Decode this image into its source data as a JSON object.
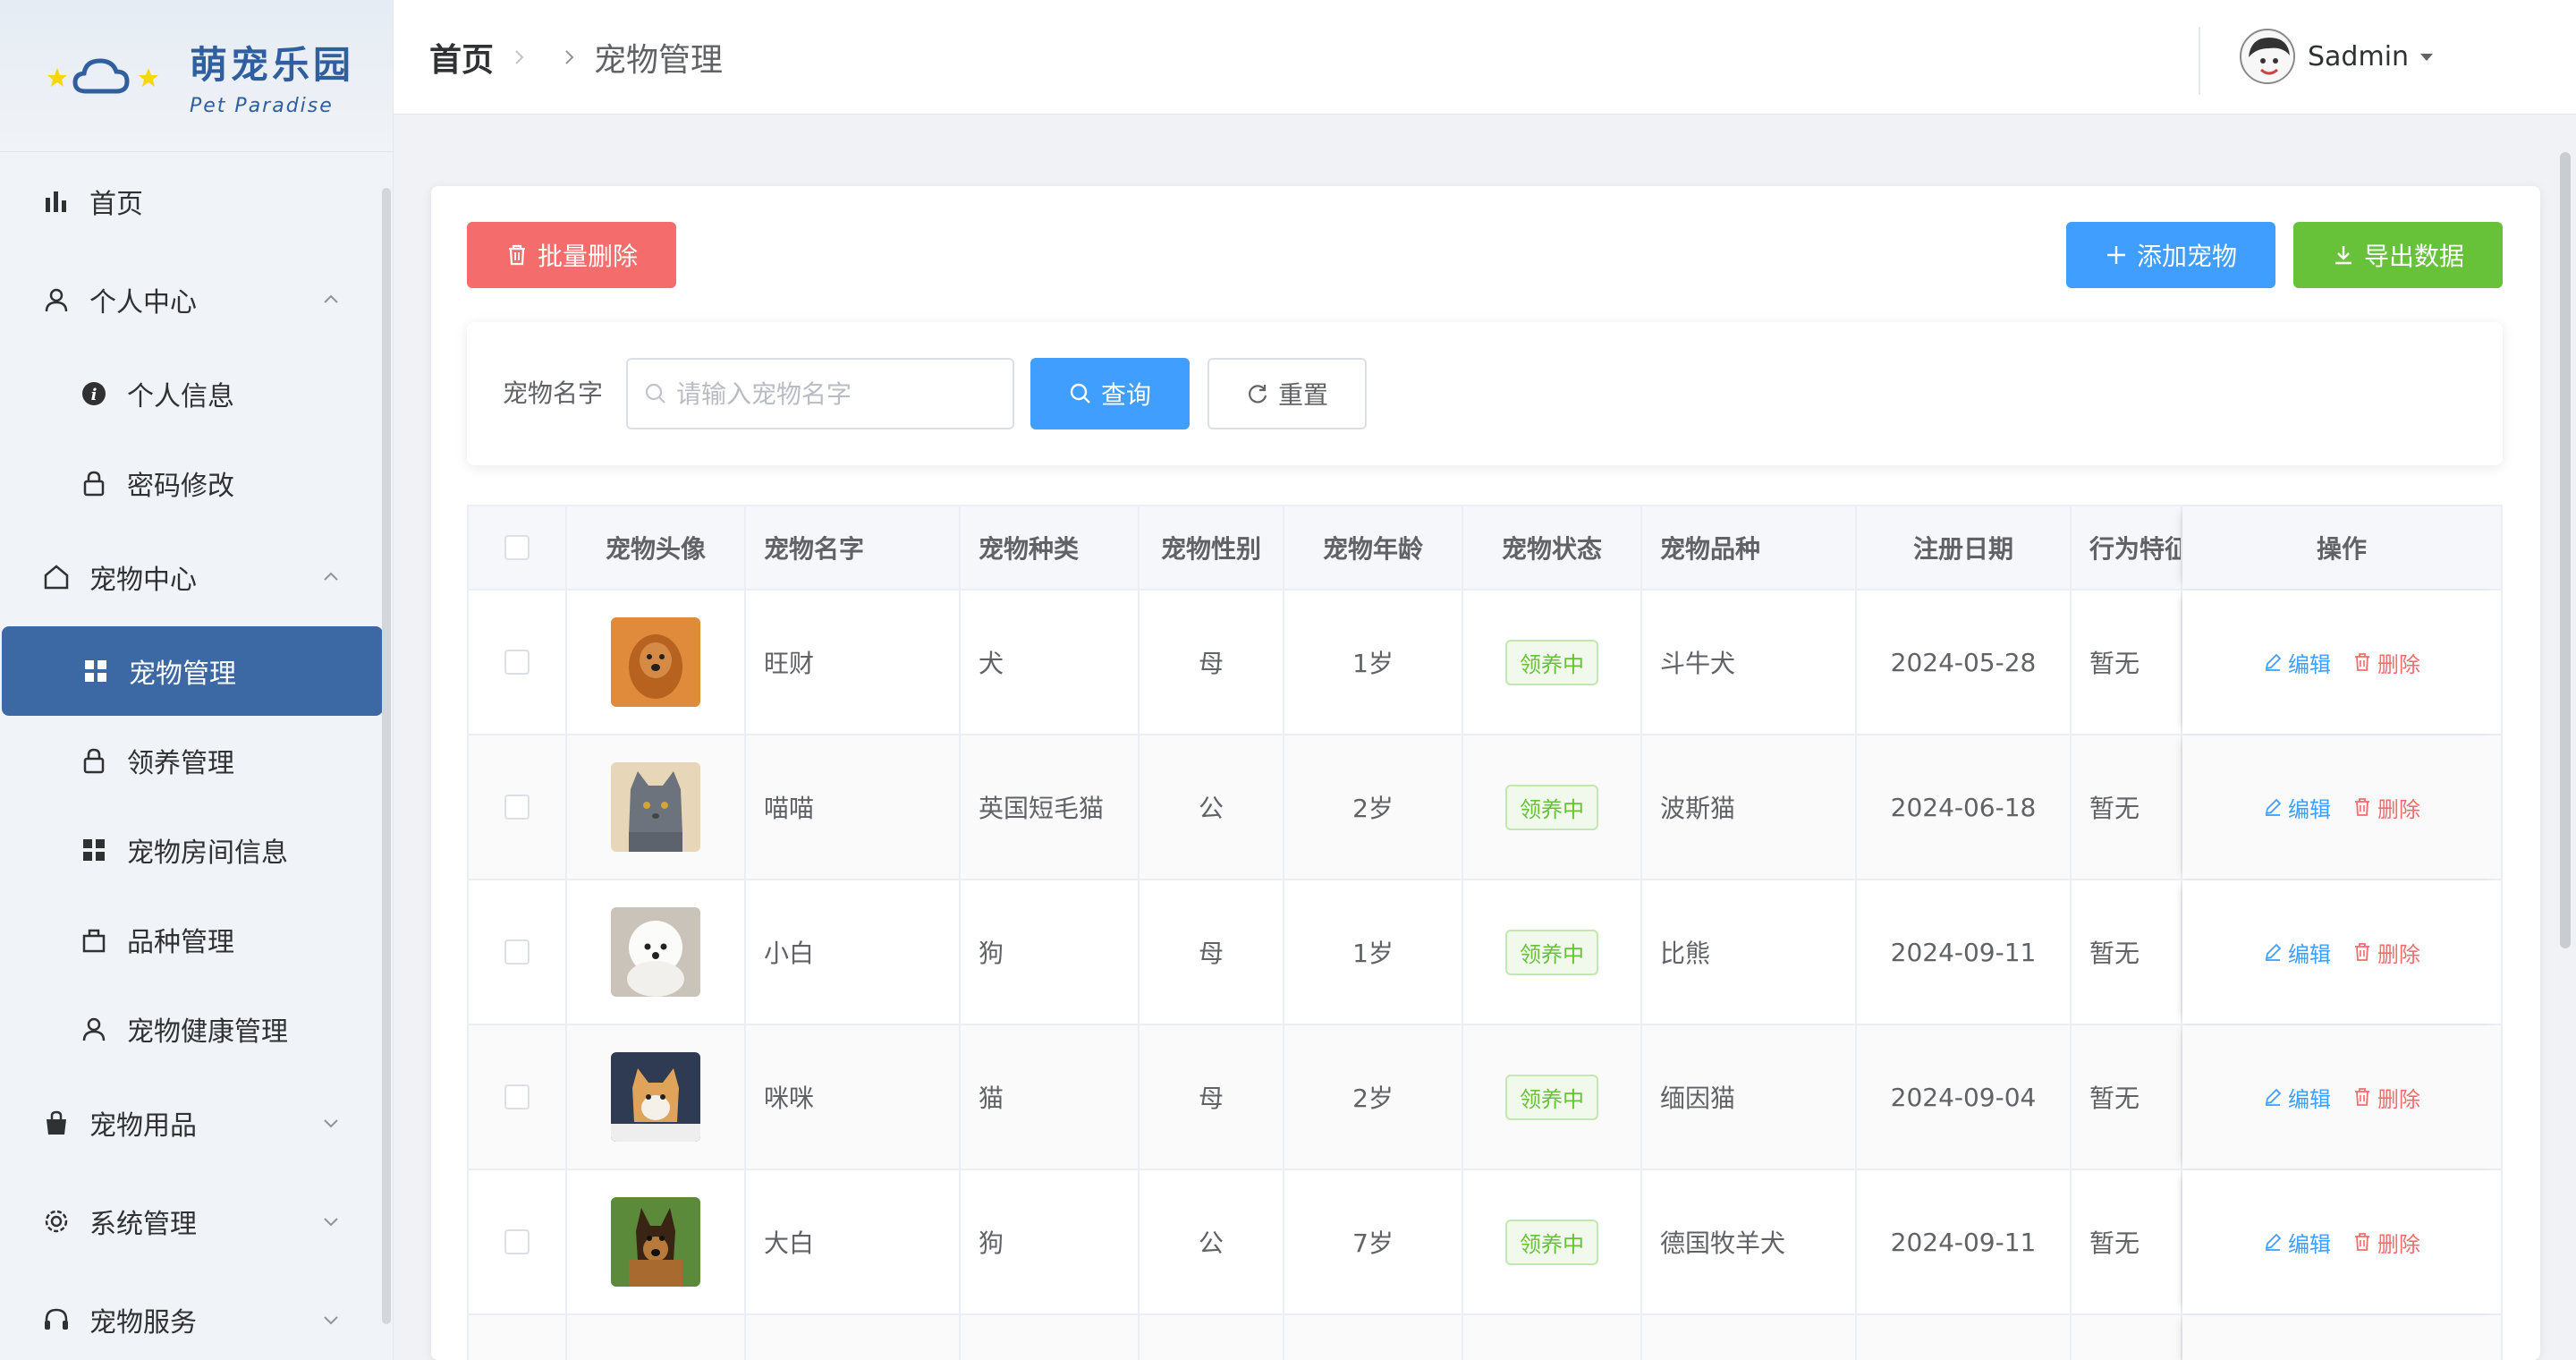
{
  "app": {
    "title": "萌宠乐园",
    "subtitle": "Pet Paradise"
  },
  "colors": {
    "sidebar_active": "#3c69a4",
    "primary": "#409eff",
    "danger": "#f56c6c",
    "success": "#67c23a"
  },
  "sidebar": {
    "items": [
      {
        "label": "首页",
        "icon": "bar-chart-icon"
      },
      {
        "label": "个人中心",
        "icon": "user-icon",
        "expanded": true
      },
      {
        "label": "个人信息",
        "icon": "info-icon"
      },
      {
        "label": "密码修改",
        "icon": "lock-icon"
      },
      {
        "label": "宠物中心",
        "icon": "home-icon",
        "expanded": true
      },
      {
        "label": "宠物管理",
        "icon": "grid-icon",
        "active": true
      },
      {
        "label": "领养管理",
        "icon": "lock-icon"
      },
      {
        "label": "宠物房间信息",
        "icon": "grid-icon"
      },
      {
        "label": "品种管理",
        "icon": "bag-icon"
      },
      {
        "label": "宠物健康管理",
        "icon": "user-icon"
      },
      {
        "label": "宠物用品",
        "icon": "shopping-bag-icon",
        "expanded": false
      },
      {
        "label": "系统管理",
        "icon": "gear-icon",
        "expanded": false
      },
      {
        "label": "宠物服务",
        "icon": "headset-icon",
        "expanded": false
      }
    ]
  },
  "header": {
    "breadcrumb_home": "首页",
    "breadcrumb_current": "宠物管理",
    "user_name": "Sadmin"
  },
  "toolbar": {
    "batch_delete": "批量删除",
    "add_pet": "添加宠物",
    "export": "导出数据"
  },
  "search": {
    "label": "宠物名字",
    "placeholder": "请输入宠物名字",
    "query": "查询",
    "reset": "重置"
  },
  "table": {
    "columns": [
      "宠物头像",
      "宠物名字",
      "宠物种类",
      "宠物性别",
      "宠物年龄",
      "宠物状态",
      "宠物品种",
      "注册日期",
      "行为特征",
      "操作"
    ],
    "rows": [
      {
        "name": "旺财",
        "type": "犬",
        "gender": "母",
        "age": "1岁",
        "status": "领养中",
        "breed": "斗牛犬",
        "date": "2024-05-28",
        "behavior": "暂无"
      },
      {
        "name": "喵喵",
        "type": "英国短毛猫",
        "gender": "公",
        "age": "2岁",
        "status": "领养中",
        "breed": "波斯猫",
        "date": "2024-06-18",
        "behavior": "暂无"
      },
      {
        "name": "小白",
        "type": "狗",
        "gender": "母",
        "age": "1岁",
        "status": "领养中",
        "breed": "比熊",
        "date": "2024-09-11",
        "behavior": "暂无"
      },
      {
        "name": "咪咪",
        "type": "猫",
        "gender": "母",
        "age": "2岁",
        "status": "领养中",
        "breed": "缅因猫",
        "date": "2024-09-04",
        "behavior": "暂无"
      },
      {
        "name": "大白",
        "type": "狗",
        "gender": "公",
        "age": "7岁",
        "status": "领养中",
        "breed": "德国牧羊犬",
        "date": "2024-09-11",
        "behavior": "暂无"
      }
    ],
    "edit_label": "编辑",
    "delete_label": "删除"
  }
}
